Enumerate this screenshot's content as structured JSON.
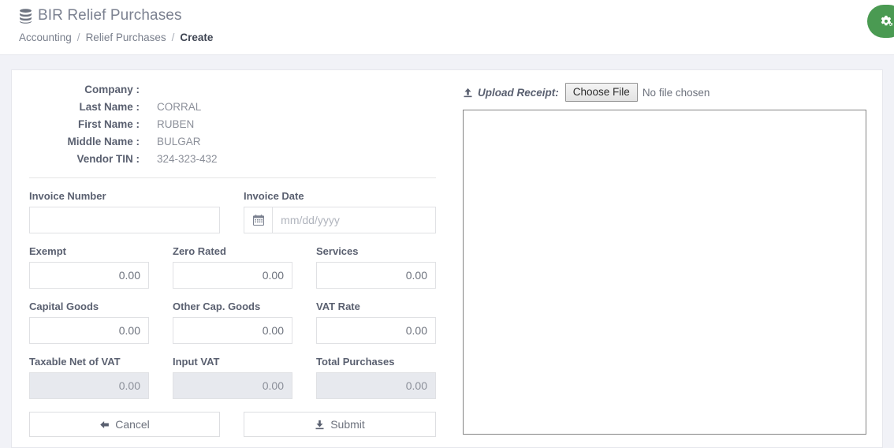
{
  "header": {
    "title": "BIR Relief Purchases",
    "title_icon": "database-icon",
    "breadcrumb": [
      {
        "label": "Accounting",
        "active": false
      },
      {
        "label": "Relief Purchases",
        "active": false
      },
      {
        "label": "Create",
        "active": true
      }
    ],
    "separator": "/",
    "fab": {
      "icon": "gears-icon",
      "color": "#4a9a52"
    }
  },
  "vendor": {
    "rows": [
      {
        "label": "Company :",
        "value": ""
      },
      {
        "label": "Last Name :",
        "value": "CORRAL"
      },
      {
        "label": "First Name :",
        "value": "RUBEN"
      },
      {
        "label": "Middle Name :",
        "value": "BULGAR"
      },
      {
        "label": "Vendor TIN :",
        "value": "324-323-432"
      }
    ]
  },
  "form": {
    "invoice_number": {
      "label": "Invoice Number",
      "value": "",
      "placeholder": ""
    },
    "invoice_date": {
      "label": "Invoice Date",
      "value": "",
      "placeholder": "mm/dd/yyyy",
      "icon": "calendar-icon"
    },
    "exempt": {
      "label": "Exempt",
      "value": "0.00"
    },
    "zero_rated": {
      "label": "Zero Rated",
      "value": "0.00"
    },
    "services": {
      "label": "Services",
      "value": "0.00"
    },
    "capital_goods": {
      "label": "Capital Goods",
      "value": "0.00"
    },
    "other_cap_goods": {
      "label": "Other Cap. Goods",
      "value": "0.00"
    },
    "vat_rate": {
      "label": "VAT Rate",
      "value": "0.00"
    },
    "taxable_net_of_vat": {
      "label": "Taxable Net of VAT",
      "value": "0.00"
    },
    "input_vat": {
      "label": "Input VAT",
      "value": "0.00"
    },
    "total_purchases": {
      "label": "Total Purchases",
      "value": "0.00"
    }
  },
  "actions": {
    "cancel": {
      "label": "Cancel",
      "icon": "arrow-left-icon"
    },
    "submit": {
      "label": "Submit",
      "icon": "download-icon"
    }
  },
  "upload": {
    "label": "Upload Receipt:",
    "icon": "upload-icon",
    "choose_button": "Choose File",
    "status": "No file chosen"
  }
}
